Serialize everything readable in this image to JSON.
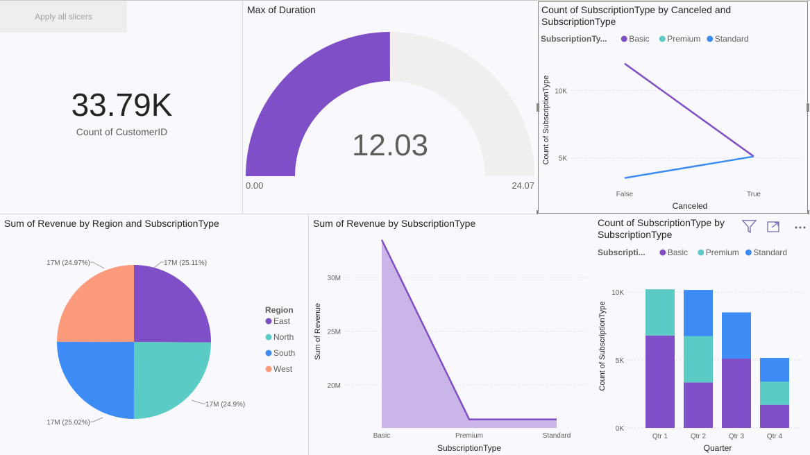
{
  "slicer_button": {
    "label": "Apply all slicers"
  },
  "card": {
    "value": "33.79K",
    "label": "Count of CustomerID"
  },
  "gauge": {
    "title": "Max of Duration",
    "value": 12.03,
    "value_label": "12.03",
    "min": 0,
    "max": 24.07,
    "min_label": "0.00",
    "max_label": "24.07",
    "fill_color": "#7f4fc8",
    "track_color": "#f1efee"
  },
  "visual_header": {
    "filter_icon": "filter-icon",
    "focus_icon": "focus-mode-icon",
    "more_icon": "more-options-icon"
  },
  "charts": {
    "line": {
      "title_line1": "Count of SubscriptionType by Canceled and",
      "title_line2": "SubscriptionType",
      "legend_title": "SubscriptionTy...",
      "chart_data": {
        "type": "line",
        "x": [
          "False",
          "True"
        ],
        "series": [
          {
            "name": "Basic",
            "color": "#7f4fc8",
            "values": [
              12000,
              5100
            ]
          },
          {
            "name": "Premium",
            "color": "#5bcbc6",
            "values": [
              null,
              null
            ]
          },
          {
            "name": "Standard",
            "color": "#3d8cf5",
            "values": [
              3500,
              5100
            ]
          }
        ],
        "xlabel": "Canceled",
        "ylabel": "Count of SubscriptionType",
        "yticks": [
          5000,
          10000
        ],
        "ytick_labels": [
          "5K",
          "10K"
        ],
        "ylim": [
          2300,
          12800
        ],
        "grid": true
      }
    },
    "pie": {
      "title": "Sum of Revenue by Region and SubscriptionType",
      "legend_title": "Region",
      "chart_data": {
        "type": "pie",
        "slices": [
          {
            "name": "East",
            "value": 25.11,
            "label": "17M (25.11%)",
            "color": "#7f4fc8"
          },
          {
            "name": "North",
            "value": 24.9,
            "label": "17M (24.9%)",
            "color": "#5bcbc6"
          },
          {
            "name": "South",
            "value": 25.02,
            "label": "17M (25.02%)",
            "color": "#3d8cf5"
          },
          {
            "name": "West",
            "value": 24.97,
            "label": "17M (24.97%)",
            "color": "#fc9a7c"
          }
        ]
      }
    },
    "area": {
      "title": "Sum of Revenue by SubscriptionType",
      "chart_data": {
        "type": "area",
        "categories": [
          "Basic",
          "Premium",
          "Standard"
        ],
        "values": [
          33500000,
          16800000,
          16800000
        ],
        "xlabel": "SubscriptionType",
        "ylabel": "Sum of Revenue",
        "yticks": [
          20000000,
          25000000,
          30000000
        ],
        "ytick_labels": [
          "20M",
          "25M",
          "30M"
        ],
        "ylim": [
          16000000,
          34600000
        ],
        "grid": true,
        "line_color": "#7f4fc8",
        "fill_color": "#c9b5e8"
      }
    },
    "bar": {
      "title_line1_visible": "Count of SubscriptionType by",
      "title_line2": "SubscriptionType",
      "legend_title": "Subscripti...",
      "chart_data": {
        "type": "bar",
        "stacked": true,
        "categories": [
          "Qtr 1",
          "Qtr 2",
          "Qtr 3",
          "Qtr 4"
        ],
        "series": [
          {
            "name": "Basic",
            "color": "#7f4fc8",
            "values": [
              6800,
              3350,
              5100,
              1700
            ]
          },
          {
            "name": "Premium",
            "color": "#5bcbc6",
            "values": [
              3400,
              3400,
              0,
              1700
            ]
          },
          {
            "name": "Standard",
            "color": "#3d8cf5",
            "values": [
              0,
              3400,
              3400,
              1750
            ]
          }
        ],
        "xlabel": "Quarter",
        "ylabel": "Count of SubscriptionType",
        "yticks": [
          0,
          5000,
          10000
        ],
        "ytick_labels": [
          "0K",
          "5K",
          "10K"
        ],
        "ylim": [
          0,
          10800
        ],
        "grid": true
      }
    }
  }
}
